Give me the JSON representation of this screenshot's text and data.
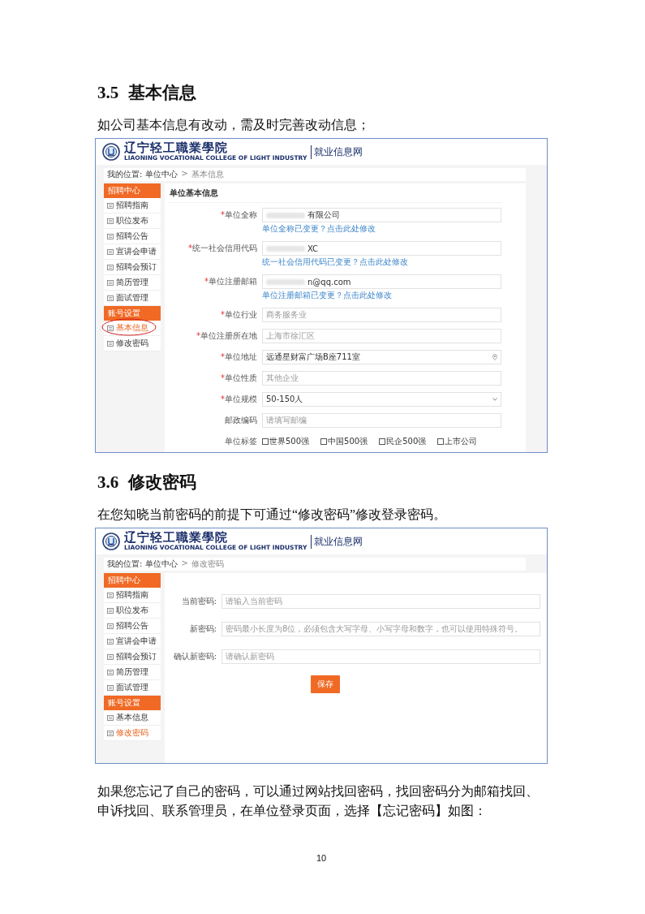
{
  "blocks": [
    {
      "kind": "heading",
      "number": "3.5",
      "title": "基本信息"
    },
    {
      "kind": "paragraph",
      "text": "如公司基本信息有改动，需及时完善改动信息；"
    },
    {
      "kind": "screenshot",
      "logo": {
        "school": "辽宁轻工職業學院",
        "school_en": "LIAONING VOCATIONAL COLLEGE OF LIGHT INDUSTRY",
        "site": "就业信息网"
      },
      "breadcrumb": {
        "label": "我的位置:",
        "items": [
          "单位中心",
          "基本信息"
        ],
        "separator": ">"
      },
      "sidebar": [
        {
          "title": "招聘中心",
          "items": [
            {
              "label": "招聘指南",
              "selected": false,
              "circled": false
            },
            {
              "label": "职位发布",
              "selected": false,
              "circled": false
            },
            {
              "label": "招聘公告",
              "selected": false,
              "circled": false
            },
            {
              "label": "宣讲会申请",
              "selected": false,
              "circled": false
            },
            {
              "label": "招聘会预订",
              "selected": false,
              "circled": false
            },
            {
              "label": "简历管理",
              "selected": false,
              "circled": false
            },
            {
              "label": "面试管理",
              "selected": false,
              "circled": false
            }
          ]
        },
        {
          "title": "账号设置",
          "items": [
            {
              "label": "基本信息",
              "selected": true,
              "circled": true
            },
            {
              "label": "修改密码",
              "selected": false,
              "circled": false
            }
          ]
        }
      ],
      "form": {
        "kind": "profile",
        "title": "单位基本信息",
        "rows": [
          {
            "kind": "text",
            "required_mark": "*",
            "label": "单位全称",
            "value": "有限公司",
            "redacted": true,
            "hint": "单位全称已变更？",
            "hint_link": "点击此处修改"
          },
          {
            "kind": "text",
            "required_mark": "*",
            "label": "统一社会信用代码",
            "value": "XC",
            "redacted": true,
            "hint": "统一社会信用代码已变更？",
            "hint_link": "点击此处修改"
          },
          {
            "kind": "text",
            "required_mark": "*",
            "label": "单位注册邮箱",
            "value": "n@qq.com",
            "redacted": true,
            "hint": "单位注册邮箱已变更？",
            "hint_link": "点击此处修改"
          },
          {
            "kind": "text",
            "required_mark": "*",
            "label": "单位行业",
            "placeholder": "商务服务业"
          },
          {
            "kind": "text",
            "required_mark": "*",
            "label": "单位注册所在地",
            "placeholder": "上海市徐汇区"
          },
          {
            "kind": "address",
            "required_mark": "*",
            "label": "单位地址",
            "value": "远通星财富广场B座711室"
          },
          {
            "kind": "text",
            "required_mark": "*",
            "label": "单位性质",
            "placeholder": "其他企业"
          },
          {
            "kind": "select",
            "required_mark": "*",
            "label": "单位规模",
            "value": "50-150人"
          },
          {
            "kind": "text",
            "label": "邮政编码",
            "placeholder": "请填写邮编"
          },
          {
            "kind": "checkboxes",
            "label": "单位标签",
            "options": [
              {
                "label": "世界500强",
                "checked": false
              },
              {
                "label": "中国500强",
                "checked": false
              },
              {
                "label": "民企500强",
                "checked": false
              },
              {
                "label": "上市公司",
                "checked": false
              }
            ]
          }
        ]
      }
    },
    {
      "kind": "heading",
      "number": "3.6",
      "title": "修改密码"
    },
    {
      "kind": "paragraph",
      "text": "在您知晓当前密码的前提下可通过“修改密码”修改登录密码。"
    },
    {
      "kind": "screenshot",
      "logo": {
        "school": "辽宁轻工職業學院",
        "school_en": "LIAONING VOCATIONAL COLLEGE OF LIGHT INDUSTRY",
        "site": "就业信息网"
      },
      "breadcrumb": {
        "label": "我的位置:",
        "items": [
          "单位中心",
          "修改密码"
        ],
        "separator": ">"
      },
      "sidebar": [
        {
          "title": "招聘中心",
          "items": [
            {
              "label": "招聘指南",
              "selected": false,
              "circled": false
            },
            {
              "label": "职位发布",
              "selected": false,
              "circled": false
            },
            {
              "label": "招聘公告",
              "selected": false,
              "circled": false
            },
            {
              "label": "宣讲会申请",
              "selected": false,
              "circled": false
            },
            {
              "label": "招聘会预订",
              "selected": false,
              "circled": false
            },
            {
              "label": "简历管理",
              "selected": false,
              "circled": false
            },
            {
              "label": "面试管理",
              "selected": false,
              "circled": false
            }
          ]
        },
        {
          "title": "账号设置",
          "items": [
            {
              "label": "基本信息",
              "selected": false,
              "circled": false
            },
            {
              "label": "修改密码",
              "selected": true,
              "circled": false
            }
          ]
        }
      ],
      "form": {
        "kind": "password",
        "rows": [
          {
            "kind": "password",
            "label": "当前密码:",
            "placeholder": "请输入当前密码"
          },
          {
            "kind": "password",
            "label": "新密码:",
            "placeholder": "密码最小长度为8位，必须包含大写字母、小写字母和数字，也可以使用特殊符号。"
          },
          {
            "kind": "password",
            "label": "确认新密码:",
            "placeholder": "请确认新密码"
          }
        ],
        "button": "保存"
      }
    },
    {
      "kind": "paragraph",
      "text": "如果您忘记了自己的密码，可以通过网站找回密码，找回密码分为邮箱找回、申诉找回、联系管理员，在单位登录页面，选择【忘记密码】如图："
    }
  ],
  "page_number": "10"
}
